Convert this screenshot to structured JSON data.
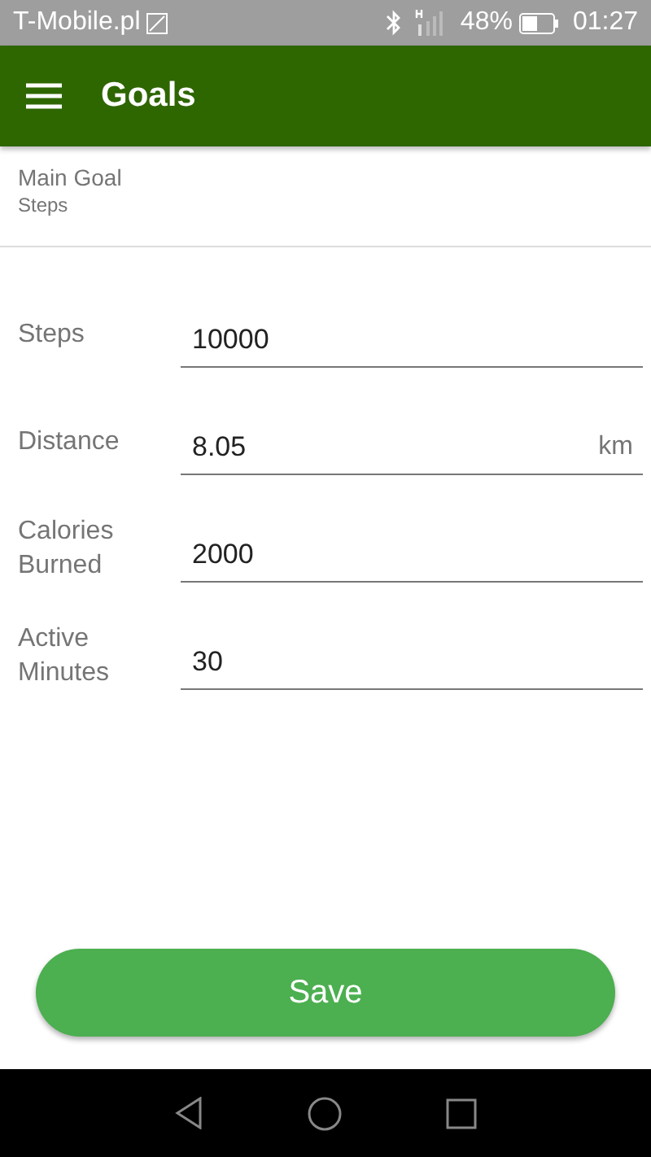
{
  "status_bar": {
    "carrier": "T-Mobile.pl",
    "battery": "48%",
    "time": "01:27"
  },
  "app_bar": {
    "title": "Goals"
  },
  "main_goal": {
    "label": "Main Goal",
    "value": "Steps"
  },
  "fields": [
    {
      "label": "Steps",
      "value": "10000"
    },
    {
      "label": "Distance",
      "value": "8.05",
      "unit": "km"
    },
    {
      "label": "Calories Burned",
      "value": "2000"
    },
    {
      "label": "Active Minutes",
      "value": "30"
    }
  ],
  "save_button": "Save"
}
